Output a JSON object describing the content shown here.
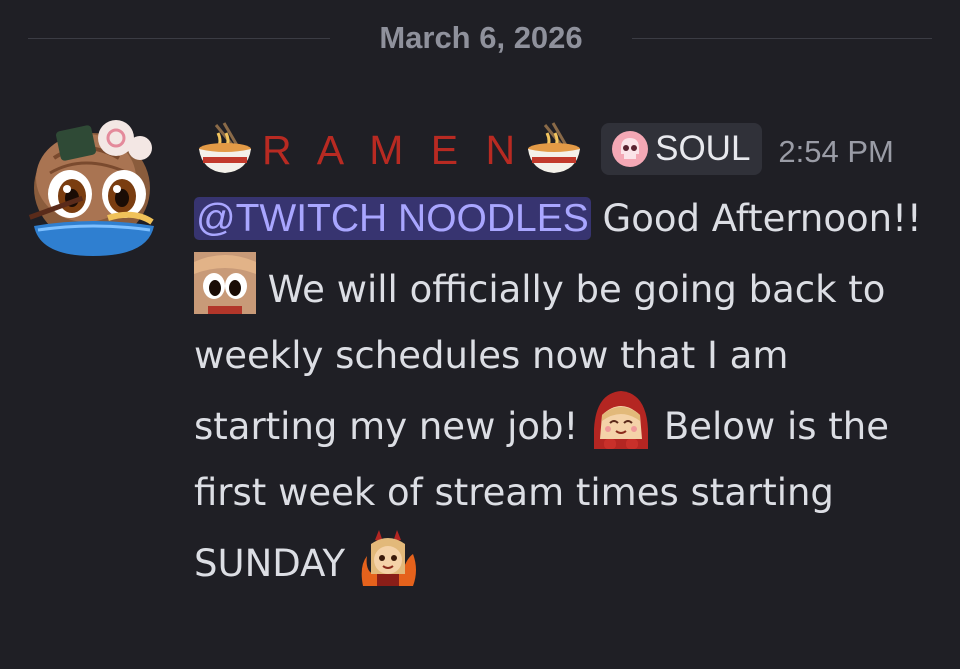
{
  "divider": {
    "date": "March 6, 2026"
  },
  "author": {
    "name": "R A M E N",
    "role": "SOUL",
    "timestamp": "2:54 PM",
    "name_color": "#b82a22"
  },
  "message": {
    "mention": "@TWITCH NOODLES",
    "text1": " Good Afternoon!! ",
    "text2": " We will officially be going back to weekly schedules now that I am starting my new job! ",
    "text3": " Below is the first week of stream times starting SUNDAY ",
    "emoji_1": "big-eyes-emoji",
    "emoji_2": "happy-girl-emoji",
    "emoji_3": "fire-horns-emoji"
  },
  "colors": {
    "background": "#1f1f25",
    "mention_bg": "#373470",
    "mention_text": "#a9a6ff",
    "text": "#dcdee4",
    "muted": "#9a9ca6"
  }
}
